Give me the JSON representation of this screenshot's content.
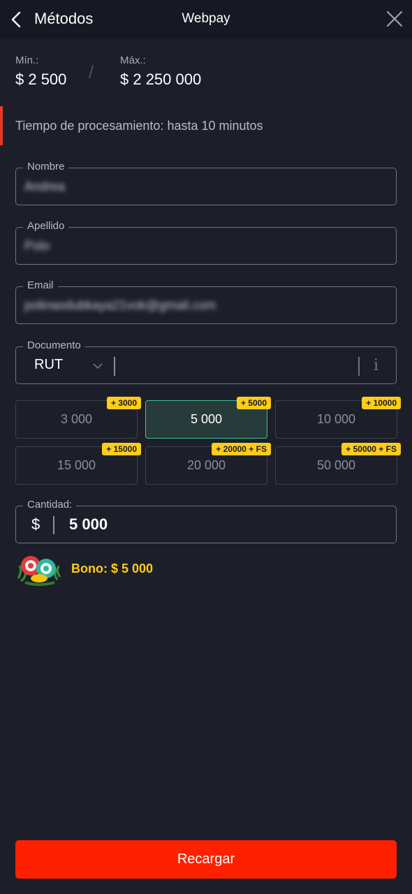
{
  "header": {
    "title": "Métodos",
    "method_name": "Webpay"
  },
  "limits": {
    "min_label": "Mín.:",
    "min_value": "$ 2 500",
    "max_label": "Máx.:",
    "max_value": "$ 2 250 000",
    "separator": "/"
  },
  "processing": {
    "text": "Tiempo de procesamiento: hasta 10 minutos"
  },
  "form": {
    "nombre": {
      "label": "Nombre",
      "value": "Andrea"
    },
    "apellido": {
      "label": "Apellido",
      "value": "Polo"
    },
    "email": {
      "label": "Email",
      "value": "polinaodubkaya21vok@gmail.com"
    },
    "documento": {
      "label": "Documento",
      "type": "RUT",
      "value": "",
      "info_glyph": "i"
    }
  },
  "amounts": [
    {
      "value": "3 000",
      "badge": "+ 3000",
      "selected": false
    },
    {
      "value": "5 000",
      "badge": "+ 5000",
      "selected": true
    },
    {
      "value": "10 000",
      "badge": "+ 10000",
      "selected": false
    },
    {
      "value": "15 000",
      "badge": "+ 15000",
      "selected": false
    },
    {
      "value": "20 000",
      "badge": "+ 20000 + FS",
      "selected": false
    },
    {
      "value": "50 000",
      "badge": "+ 50000 + FS",
      "selected": false
    }
  ],
  "cantidad": {
    "label": "Cantidad:",
    "currency": "$",
    "value": "5 000"
  },
  "bonus": {
    "text": "Bono: $ 5 000",
    "icon": "casino-chips-icon"
  },
  "submit": {
    "label": "Recargar"
  },
  "colors": {
    "background": "#1c1f2a",
    "accent": "#ff2000",
    "bonus": "#ffcc1a",
    "selected_border": "#3cc29a"
  }
}
